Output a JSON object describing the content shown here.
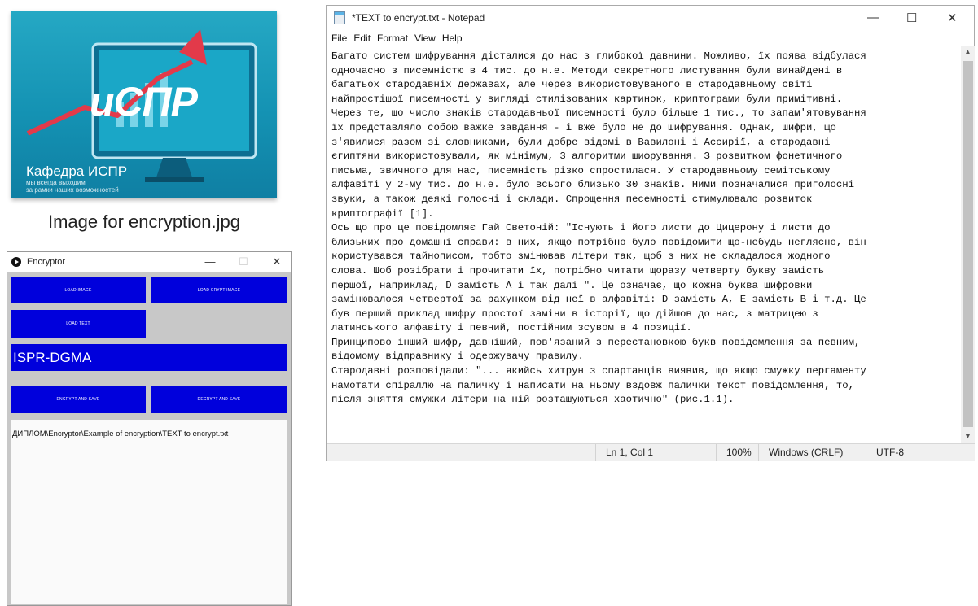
{
  "image_tile": {
    "logo_text": "иСПР",
    "department": "Кафедра ИСПР",
    "slogan_line1": "мы всегда выходим",
    "slogan_line2": "за рамки наших возможностей",
    "caption": "Image for encryption.jpg",
    "colors": {
      "background": "#1492b3",
      "arrow": "#e23a4a"
    }
  },
  "encryptor": {
    "title": "Encryptor",
    "controls": {
      "minimize": "—",
      "maximize": "☐",
      "close": "✕"
    },
    "buttons": {
      "load_image": "LOAD IMAGE",
      "load_crypt_image": "LOAD CRYPT IMAGE",
      "load_text": "LOAD TEXT",
      "encrypt_save": "ENCRYPT AND SAVE",
      "decrypt_save": "DECRYPT AND SAVE"
    },
    "key_value": "ISPR-DGMA",
    "file_path": "ДИПЛОМ\\Encryptor\\Example of encryption\\TEXT to encrypt.txt",
    "colors": {
      "button": "#0000dc",
      "window_bg": "#c8c8c8"
    }
  },
  "notepad": {
    "title": "*TEXT to encrypt.txt - Notepad",
    "controls": {
      "minimize": "—",
      "maximize": "☐",
      "close": "✕"
    },
    "menu": {
      "file": "File",
      "edit": "Edit",
      "format": "Format",
      "view": "View",
      "help": "Help"
    },
    "lines": [
      "Багато систем шифрування дісталися до нас з глибокої давнини. Можливо, їх поява відбулася",
      "одночасно з писемністю в 4 тис. до н.е. Методи секретного листування були винайдені в",
      "багатьох стародавніх державах, але через використовуваного в стародавньому світі",
      "найпростішої писемності у вигляді стилізованих картинок, криптограми були примітивні.",
      "Через те, що число знаків стародавньої писемності було більше 1 тис., то запам'ятовування",
      "їх представляло собою важке завдання - і вже було не до шифрування. Однак, шифри, що",
      "з'явилися разом зі словниками, були добре відомі в Вавилоні і Ассирії, а стародавні",
      "єгиптяни використовували, як мінімум, 3 алгоритми шифрування. З розвитком фонетичного",
      "письма, звичного для нас, писемність різко спростилася. У стародавньому семітському",
      "алфавіті у 2-му тис. до н.е. було всього близько 30 знаків. Ними позначалися приголосні",
      "звуки, а також деякі голосні і склади. Спрощення песемності стимулювало розвиток",
      "криптографії [1].",
      "Ось що про це повідомляє Гай Светоній: \"Існують і його листи до Цицерону і листи до",
      "близьких про домашні справи: в них, якщо потрібно було повідомити що-небудь неглясно, він",
      "користувався тайнописом, тобто змінював літери так, щоб з них не складалося жодного",
      "слова. Щоб розібрати і прочитати їх, потрібно читати щоразу четверту букву замість",
      "першої, наприклад, D замість А і так далі \". Це означає, що кожна буква шифровки",
      "замінювалося четвертої за рахунком від неї в алфавіті: D замість А, Е замість В і т.д. Це",
      "був перший приклад шифру простої заміни в історії, що дійшов до нас, з матрицею з",
      "латинського алфавіту і певний, постійним зсувом в 4 позиції.",
      "Принципово інший шифр, давніший, пов'язаний з перестановкою букв повідомлення за певним,",
      "відомому відправнику і одержувачу правилу.",
      "Стародавні розповідали: \"... якийсь хитрун з спартанців виявив, що якщо смужку пергаменту",
      "намотати спіраллю на паличку і написати на ньому вздовж палички текст повідомлення, то,",
      "після зняття смужки літери на ній розташуються хаотично\" (рис.1.1)."
    ],
    "status": {
      "position": "Ln 1, Col 1",
      "zoom": "100%",
      "line_ending": "Windows (CRLF)",
      "encoding": "UTF-8"
    }
  }
}
